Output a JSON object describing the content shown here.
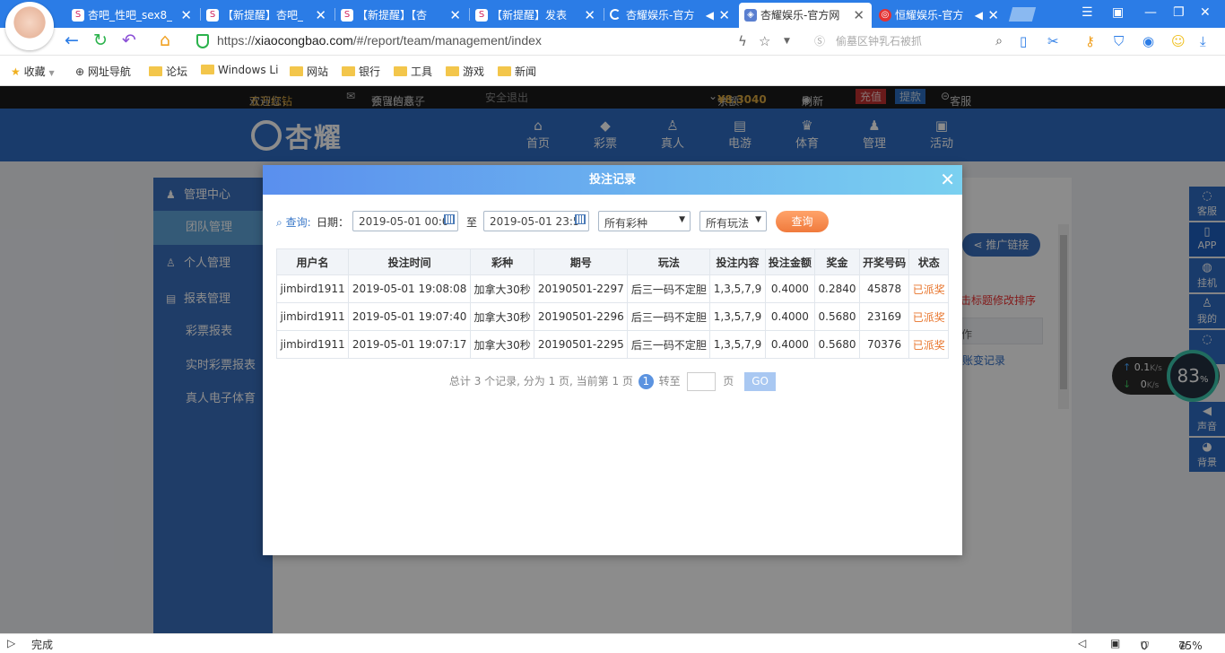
{
  "browser": {
    "tabs": [
      {
        "title": "杏吧_性吧_sex8_",
        "icon": "s8"
      },
      {
        "title": "【新提醒】杏吧_",
        "icon": "s8"
      },
      {
        "title": "【新提醒】【杏",
        "icon": "s8"
      },
      {
        "title": "【新提醒】发表",
        "icon": "s8"
      },
      {
        "title": "杏耀娱乐-官方",
        "icon": "loading"
      },
      {
        "title": "杏耀娱乐-官方网",
        "icon": "doc"
      },
      {
        "title": "恒耀娱乐-官方",
        "icon": "red"
      }
    ],
    "url_scheme": "https://",
    "url_host": "xiaocongbao.com",
    "url_path": "/#/report/team/management/index",
    "search_placeholder": "偷墓区钟乳石被抓",
    "bookmarks": [
      "收藏",
      "网址导航",
      "论坛",
      "Windows Li",
      "网站",
      "银行",
      "工具",
      "游戏",
      "新闻"
    ],
    "status_left": "完成",
    "status_count": "0",
    "zoom": "75%"
  },
  "site": {
    "welcome": "欢迎您，",
    "username": "五万红钻",
    "notice_label": "预留信息：",
    "notice_value": "会飞的燕子",
    "logout": "安全退出",
    "balance_label": "余额:",
    "balance_value": "¥8.3040",
    "refresh": "刷新",
    "deposit": "充值",
    "withdraw": "提款",
    "service": "客服",
    "logo_text": "杏耀",
    "nav": [
      {
        "label": "首页",
        "icon": "home-icon"
      },
      {
        "label": "彩票",
        "icon": "diamond-icon"
      },
      {
        "label": "真人",
        "icon": "person-icon"
      },
      {
        "label": "电游",
        "icon": "game-icon"
      },
      {
        "label": "体育",
        "icon": "trophy-icon"
      },
      {
        "label": "管理",
        "icon": "users-icon"
      },
      {
        "label": "活动",
        "icon": "gift-icon"
      }
    ],
    "side_menu": {
      "group1": "管理中心",
      "item_team": "团队管理",
      "group2": "个人管理",
      "group3": "报表管理",
      "item_lottery": "彩票报表",
      "item_realtime": "实时彩票报表",
      "item_live": "真人电子体育"
    },
    "promo_link": "推广链接",
    "sort_hint": "击标题修改排序",
    "bg_col_label": "作",
    "ledger_link": "账变记录",
    "right_bar": [
      "客服",
      "APP",
      "挂机",
      "我的",
      "",
      "声音",
      "背景"
    ],
    "speed_up": "0.1",
    "speed_up_unit": "K/s",
    "speed_down": "0",
    "speed_down_unit": "K/s",
    "gauge_value": "83",
    "gauge_unit": "%"
  },
  "modal": {
    "title": "投注记录",
    "query_label": "查询:",
    "date_label": "日期：",
    "date_from": "2019-05-01 00:0",
    "to_label": "至",
    "date_to": "2019-05-01 23:5",
    "lottery_select": "所有彩种",
    "play_select": "所有玩法",
    "query_button": "查询",
    "columns": [
      "用户名",
      "投注时间",
      "彩种",
      "期号",
      "玩法",
      "投注内容",
      "投注金额",
      "奖金",
      "开奖号码",
      "状态"
    ],
    "rows": [
      [
        "jimbird1911",
        "2019-05-01 19:08:08",
        "加拿大30秒",
        "20190501-2297",
        "后三一码不定胆",
        "1,3,5,7,9",
        "0.4000",
        "0.2840",
        "45878",
        "已派奖"
      ],
      [
        "jimbird1911",
        "2019-05-01 19:07:40",
        "加拿大30秒",
        "20190501-2296",
        "后三一码不定胆",
        "1,3,5,7,9",
        "0.4000",
        "0.5680",
        "23169",
        "已派奖"
      ],
      [
        "jimbird1911",
        "2019-05-01 19:07:17",
        "加拿大30秒",
        "20190501-2295",
        "后三一码不定胆",
        "1,3,5,7,9",
        "0.4000",
        "0.5680",
        "70376",
        "已派奖"
      ]
    ],
    "pager_text": "总计 3 个记录, 分为 1 页, 当前第 1 页",
    "page_current": "1",
    "goto_label": "转至",
    "page_unit": "页",
    "go_button": "GO"
  }
}
